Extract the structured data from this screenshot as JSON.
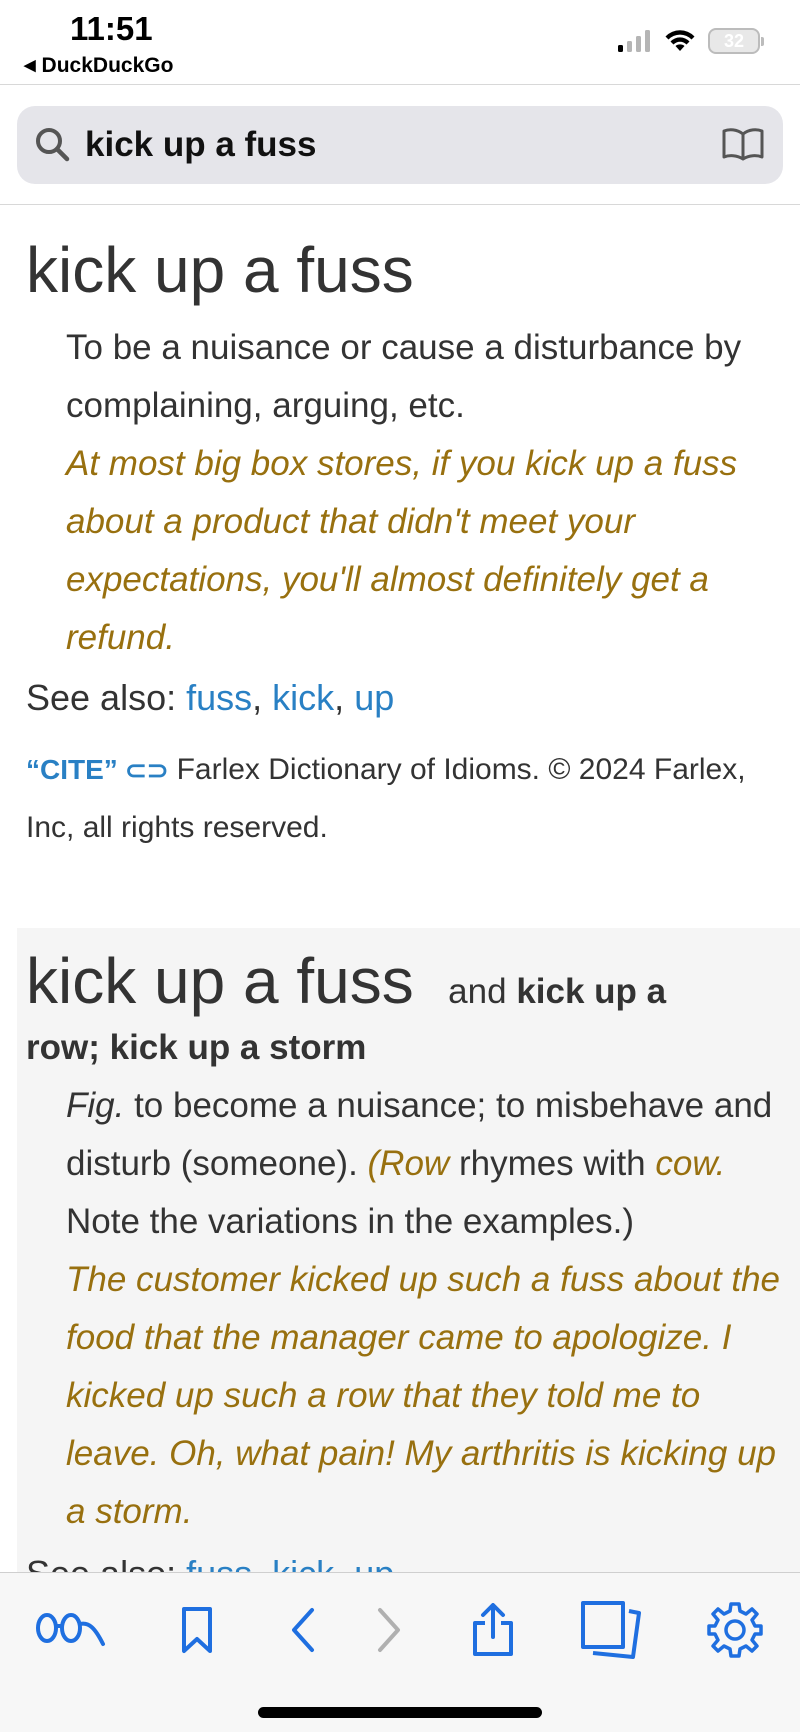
{
  "status": {
    "time": "11:51",
    "back_app": "DuckDuckGo",
    "battery": "32"
  },
  "search": {
    "query": "kick up a fuss"
  },
  "entry1": {
    "headword": "kick up a fuss",
    "definition": "To be a nuisance or cause a disturbance by complaining, arguing, etc.",
    "example": "At most big box stores, if you kick up a fuss about a product that didn't meet your expectations, you'll almost definitely get a refund.",
    "see_also_label": "See also:",
    "see_also": [
      "fuss",
      "kick",
      "up"
    ],
    "cite_label": "“CITE”",
    "cite_text": "Farlex Dictionary of Idioms. © 2024 Farlex, Inc, all rights reserved."
  },
  "entry2": {
    "headword": "kick up a fuss",
    "and_text": "and",
    "alt1": "kick up a",
    "alt2": "row; kick up a storm",
    "fig": "Fig.",
    "definition": " to become a nuisance; to misbehave and disturb (someone). ",
    "row_paren": "(Row",
    "rhymes_with": " rhymes with ",
    "cow": "cow.",
    "note": " Note the variations in the examples.)",
    "examples": "The customer kicked up such a fuss about the food that the manager came to apologize. I kicked up such a row that they told me to leave. Oh, what pain! My arthritis is kicking up a storm.",
    "see_also_label": "See also:",
    "see_also": [
      "fuss",
      "kick",
      "up"
    ]
  },
  "colors": {
    "link": "#2980c4",
    "example": "#98700f",
    "toolbar_icon": "#1f6fe0"
  }
}
